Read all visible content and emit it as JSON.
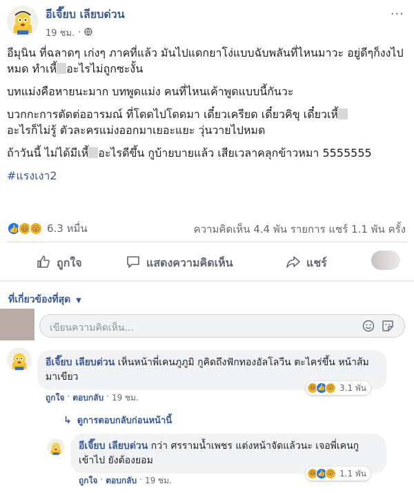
{
  "post": {
    "author": "อีเจี๊ยบ เลียบด่วน",
    "time": "19 ชม.",
    "more_icon": "···",
    "paragraphs": [
      [
        "อีมุนิน ที่ฉลาดๆ เก่งๆ ภาคที่แล้ว มันไปแดกยาโง่แบบฉับพลันที่ไหนมาวะ อยู่ดีๆก็งงไปหมด ทำเหี้",
        "อะไรไม่ถูกซะงั้น"
      ],
      [
        "บทแม่งคือหายนะมาก บทพูดแม่ง คนที่ไหนเค้าพูดแบบนี้กันวะ"
      ],
      [
        "บวกกะการตัดต่ออารมณ์ ที่โดดไปโดดมา เดี๋ยวเครียด เดี๋ยวคิขุ เดี๋ยวเหี้",
        "อะไรก็ไม่รู้ ตัวละครแม่งออกมาเยอะแยะ วุ่นวายไปหมด"
      ],
      [
        "ถ้าวันนี้ ไม่ได้มีเหี้",
        "อะไรดีขึ้น กูบ้ายบายแล้ว เสียเวลาคลุกข้าวหมา 5555555"
      ]
    ],
    "hashtag": "#แรงเงา2",
    "reaction_count": "6.3 หมื่น",
    "stats": "ความคิดเห็น 4.4 พัน รายการ  แชร์ 1.1 พัน ครั้ง"
  },
  "actions": {
    "like": "ถูกใจ",
    "comment": "แสดงความคิดเห็น",
    "share": "แชร์"
  },
  "filter": "ที่เกี่ยวข้องที่สุด",
  "composer": {
    "placeholder": "เขียนความคิดเห็น..."
  },
  "comments": [
    {
      "name": "อีเจี๊ยบ เลียบด่วน",
      "text": "เห็นหน้าพี่เคนภูภูมิ กูคิดถึงฟักทองอัลโลวีน ตะไคร่ขึ้น หน้าส้มมาเขียว",
      "like": "ถูกใจ",
      "reply": "ตอบกลับ",
      "time": "19 ชม.",
      "reactions": "3.1 พัน"
    },
    {
      "name": "อีเจี๊ยบ เลียบด่วน",
      "text": "กว่า ศรรามน้ำเพชร แต่งหน้าจัดแล้วนะ เจอพี่เคนกูเข้าไป ยังต้องยอม",
      "like": "ถูกใจ",
      "reply": "ตอบกลับ",
      "time": "19 ชม.",
      "reactions": "1.1 พัน"
    }
  ],
  "view_previous": "ดูการตอบกลับก่อนหน้านี้",
  "colors": {
    "link": "#385898",
    "muted": "#606770",
    "bubble": "#f2f3f5",
    "haha": "#f7b125",
    "like": "#1877f2"
  }
}
